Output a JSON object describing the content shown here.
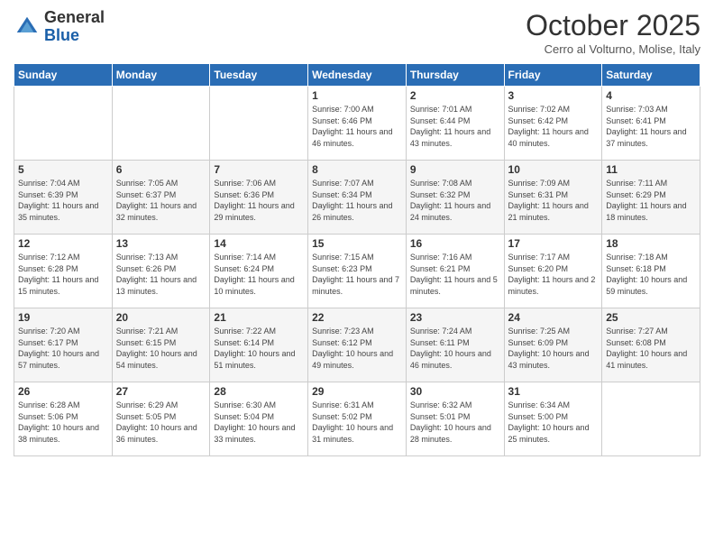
{
  "header": {
    "logo_general": "General",
    "logo_blue": "Blue",
    "month_title": "October 2025",
    "subtitle": "Cerro al Volturno, Molise, Italy"
  },
  "days_of_week": [
    "Sunday",
    "Monday",
    "Tuesday",
    "Wednesday",
    "Thursday",
    "Friday",
    "Saturday"
  ],
  "weeks": [
    [
      {
        "day": "",
        "info": ""
      },
      {
        "day": "",
        "info": ""
      },
      {
        "day": "",
        "info": ""
      },
      {
        "day": "1",
        "info": "Sunrise: 7:00 AM\nSunset: 6:46 PM\nDaylight: 11 hours\nand 46 minutes."
      },
      {
        "day": "2",
        "info": "Sunrise: 7:01 AM\nSunset: 6:44 PM\nDaylight: 11 hours\nand 43 minutes."
      },
      {
        "day": "3",
        "info": "Sunrise: 7:02 AM\nSunset: 6:42 PM\nDaylight: 11 hours\nand 40 minutes."
      },
      {
        "day": "4",
        "info": "Sunrise: 7:03 AM\nSunset: 6:41 PM\nDaylight: 11 hours\nand 37 minutes."
      }
    ],
    [
      {
        "day": "5",
        "info": "Sunrise: 7:04 AM\nSunset: 6:39 PM\nDaylight: 11 hours\nand 35 minutes."
      },
      {
        "day": "6",
        "info": "Sunrise: 7:05 AM\nSunset: 6:37 PM\nDaylight: 11 hours\nand 32 minutes."
      },
      {
        "day": "7",
        "info": "Sunrise: 7:06 AM\nSunset: 6:36 PM\nDaylight: 11 hours\nand 29 minutes."
      },
      {
        "day": "8",
        "info": "Sunrise: 7:07 AM\nSunset: 6:34 PM\nDaylight: 11 hours\nand 26 minutes."
      },
      {
        "day": "9",
        "info": "Sunrise: 7:08 AM\nSunset: 6:32 PM\nDaylight: 11 hours\nand 24 minutes."
      },
      {
        "day": "10",
        "info": "Sunrise: 7:09 AM\nSunset: 6:31 PM\nDaylight: 11 hours\nand 21 minutes."
      },
      {
        "day": "11",
        "info": "Sunrise: 7:11 AM\nSunset: 6:29 PM\nDaylight: 11 hours\nand 18 minutes."
      }
    ],
    [
      {
        "day": "12",
        "info": "Sunrise: 7:12 AM\nSunset: 6:28 PM\nDaylight: 11 hours\nand 15 minutes."
      },
      {
        "day": "13",
        "info": "Sunrise: 7:13 AM\nSunset: 6:26 PM\nDaylight: 11 hours\nand 13 minutes."
      },
      {
        "day": "14",
        "info": "Sunrise: 7:14 AM\nSunset: 6:24 PM\nDaylight: 11 hours\nand 10 minutes."
      },
      {
        "day": "15",
        "info": "Sunrise: 7:15 AM\nSunset: 6:23 PM\nDaylight: 11 hours\nand 7 minutes."
      },
      {
        "day": "16",
        "info": "Sunrise: 7:16 AM\nSunset: 6:21 PM\nDaylight: 11 hours\nand 5 minutes."
      },
      {
        "day": "17",
        "info": "Sunrise: 7:17 AM\nSunset: 6:20 PM\nDaylight: 11 hours\nand 2 minutes."
      },
      {
        "day": "18",
        "info": "Sunrise: 7:18 AM\nSunset: 6:18 PM\nDaylight: 10 hours\nand 59 minutes."
      }
    ],
    [
      {
        "day": "19",
        "info": "Sunrise: 7:20 AM\nSunset: 6:17 PM\nDaylight: 10 hours\nand 57 minutes."
      },
      {
        "day": "20",
        "info": "Sunrise: 7:21 AM\nSunset: 6:15 PM\nDaylight: 10 hours\nand 54 minutes."
      },
      {
        "day": "21",
        "info": "Sunrise: 7:22 AM\nSunset: 6:14 PM\nDaylight: 10 hours\nand 51 minutes."
      },
      {
        "day": "22",
        "info": "Sunrise: 7:23 AM\nSunset: 6:12 PM\nDaylight: 10 hours\nand 49 minutes."
      },
      {
        "day": "23",
        "info": "Sunrise: 7:24 AM\nSunset: 6:11 PM\nDaylight: 10 hours\nand 46 minutes."
      },
      {
        "day": "24",
        "info": "Sunrise: 7:25 AM\nSunset: 6:09 PM\nDaylight: 10 hours\nand 43 minutes."
      },
      {
        "day": "25",
        "info": "Sunrise: 7:27 AM\nSunset: 6:08 PM\nDaylight: 10 hours\nand 41 minutes."
      }
    ],
    [
      {
        "day": "26",
        "info": "Sunrise: 6:28 AM\nSunset: 5:06 PM\nDaylight: 10 hours\nand 38 minutes."
      },
      {
        "day": "27",
        "info": "Sunrise: 6:29 AM\nSunset: 5:05 PM\nDaylight: 10 hours\nand 36 minutes."
      },
      {
        "day": "28",
        "info": "Sunrise: 6:30 AM\nSunset: 5:04 PM\nDaylight: 10 hours\nand 33 minutes."
      },
      {
        "day": "29",
        "info": "Sunrise: 6:31 AM\nSunset: 5:02 PM\nDaylight: 10 hours\nand 31 minutes."
      },
      {
        "day": "30",
        "info": "Sunrise: 6:32 AM\nSunset: 5:01 PM\nDaylight: 10 hours\nand 28 minutes."
      },
      {
        "day": "31",
        "info": "Sunrise: 6:34 AM\nSunset: 5:00 PM\nDaylight: 10 hours\nand 25 minutes."
      },
      {
        "day": "",
        "info": ""
      }
    ]
  ]
}
